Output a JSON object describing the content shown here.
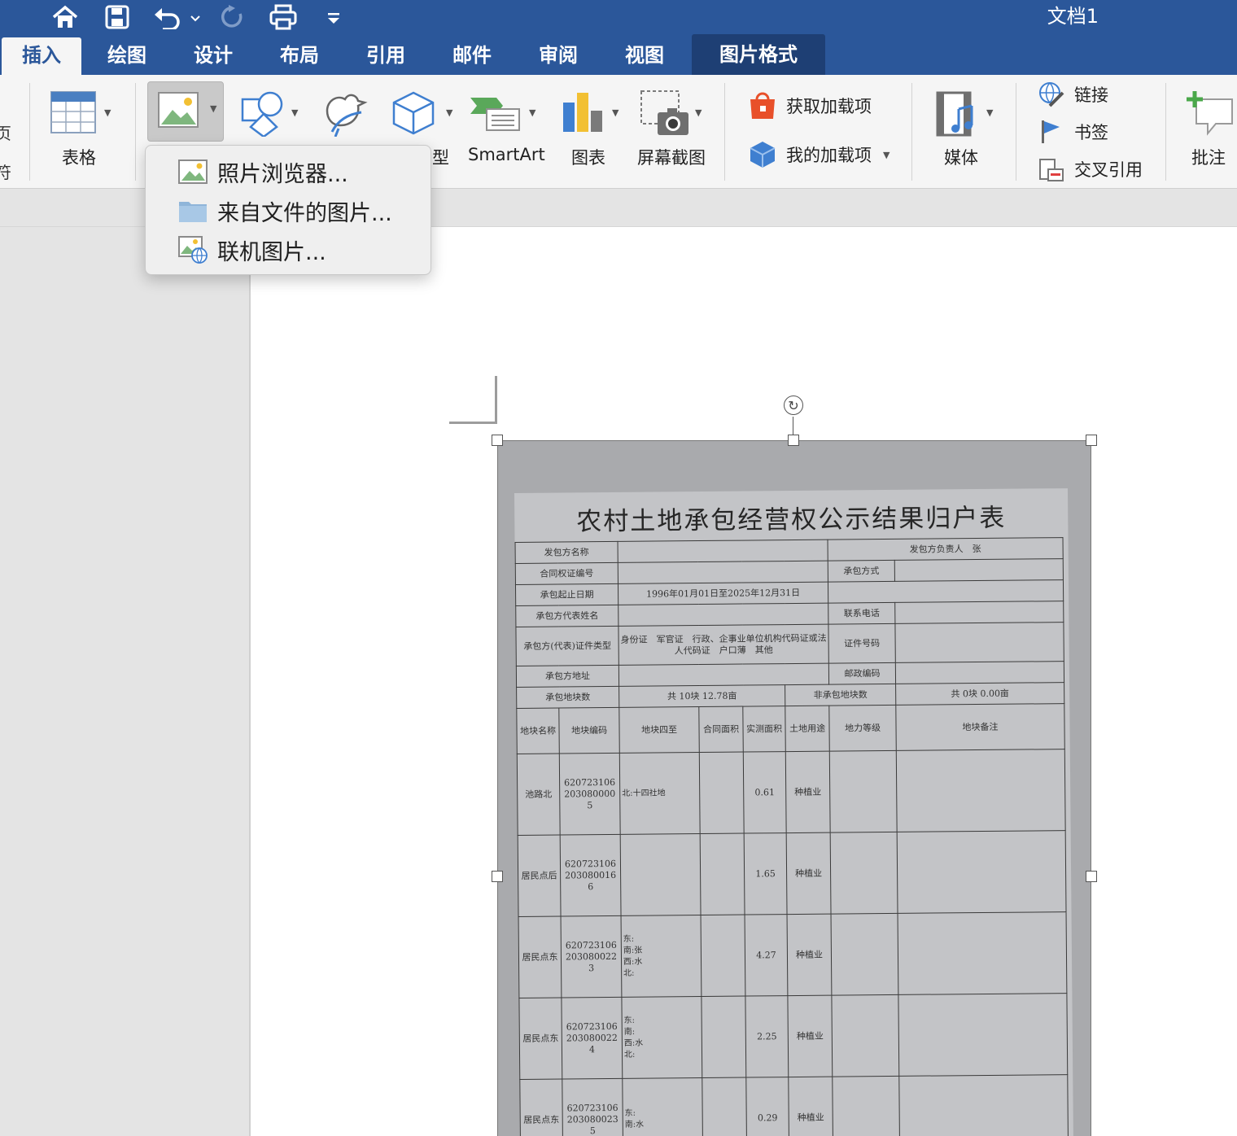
{
  "window": {
    "title": "文档1"
  },
  "quick_access": {
    "icons": [
      "home-icon",
      "save-icon",
      "undo-icon",
      "redo-icon",
      "print-icon",
      "customize-icon"
    ]
  },
  "tabs": [
    {
      "label": "插入",
      "active": true
    },
    {
      "label": "绘图"
    },
    {
      "label": "设计"
    },
    {
      "label": "布局"
    },
    {
      "label": "引用"
    },
    {
      "label": "邮件"
    },
    {
      "label": "审阅"
    },
    {
      "label": "视图"
    },
    {
      "label": "图片格式",
      "contextual": true
    }
  ],
  "ribbon": {
    "cut_left": [
      "页",
      "符"
    ],
    "table_label": "表格",
    "model_partial": "型",
    "smartart_label": "SmartArt",
    "chart_label": "图表",
    "screenshot_label": "屏幕截图",
    "get_addins_label": "获取加载项",
    "my_addins_label": "我的加载项",
    "media_label": "媒体",
    "link_label": "链接",
    "bookmark_label": "书签",
    "crossref_label": "交叉引用",
    "comment_label": "批注"
  },
  "picture_menu": {
    "items": [
      {
        "label": "照片浏览器...",
        "icon": "photo-icon"
      },
      {
        "label": "来自文件的图片...",
        "icon": "folder-icon"
      },
      {
        "label": "联机图片...",
        "icon": "online-picture-icon"
      }
    ]
  },
  "document_image": {
    "title": "农村土地承包经营权公示结果归户表",
    "fields": {
      "contractor_name": "发包方名称",
      "contractor_head": "发包方负责人",
      "head_value": "张",
      "contract_no": "合同权证编号",
      "contract_method": "承包方式",
      "contract_period": "承包起止日期",
      "period_value": "1996年01月01日至2025年12月31日",
      "rep_name": "承包方代表姓名",
      "phone": "联系电话",
      "id_type": "承包方(代表)证件类型",
      "id_options": "身份证　军官证　行政、企事业单位机构代码证或法人代码证　户口薄　其他",
      "id_no": "证件号码",
      "address": "承包方地址",
      "postcode": "邮政编码",
      "plot_count": "承包地块数",
      "plot_count_value": "共 10块 12.78亩",
      "non_plot_count": "非承包地块数",
      "non_plot_value": "共 0块 0.00亩"
    },
    "columns": [
      "地块名称",
      "地块编码",
      "地块四至",
      "合同面积",
      "实测面积",
      "土地用途",
      "地力等级",
      "地块备注"
    ],
    "rows": [
      {
        "name": "池路北",
        "code": "6207231062030800005",
        "bounds": "北:十四社地",
        "area": "0.61",
        "use": "种植业"
      },
      {
        "name": "居民点后",
        "code": "6207231062030800166",
        "bounds": "",
        "area": "1.65",
        "use": "种植业"
      },
      {
        "name": "居民点东",
        "code": "6207231062030800223",
        "bounds": "东:\n南:张\n西:水\n北:",
        "area": "4.27",
        "use": "种植业"
      },
      {
        "name": "居民点东",
        "code": "6207231062030800224",
        "bounds": "东:\n南:\n西:水\n北:",
        "area": "2.25",
        "use": "种植业"
      },
      {
        "name": "居民点东",
        "code": "6207231062030800235",
        "bounds": "东:\n南:水",
        "area": "0.29",
        "use": "种植业"
      }
    ]
  }
}
